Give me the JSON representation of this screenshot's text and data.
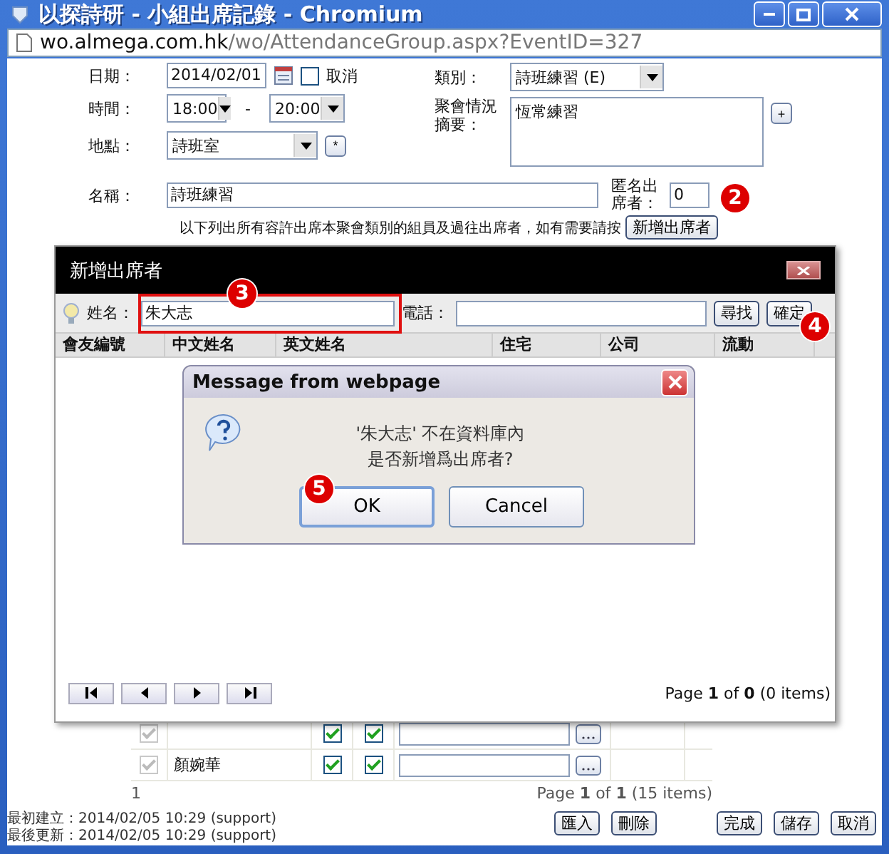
{
  "window": {
    "title": "以探詩研 - 小組出席記錄 - Chromium"
  },
  "address_bar": {
    "host": "wo.almega.com.hk",
    "path": "/wo/AttendanceGroup.aspx?EventID=327"
  },
  "form": {
    "date_label": "日期：",
    "date": "2014/02/01",
    "cancel_label": "取消",
    "cancel_checked": false,
    "time_label": "時間：",
    "start_time": "18:00",
    "time_dash": "-",
    "end_time": "20:00",
    "place_label": "地點：",
    "place": "詩班室",
    "place_button": "*",
    "category_label": "類別：",
    "category": "詩班練習 (E)",
    "summary_label": "聚會情況摘要：",
    "summary": "恆常練習",
    "summary_button": "+",
    "name_label": "名稱：",
    "name": "詩班練習",
    "anonymous_label": "匿名出席者：",
    "anonymous": "0",
    "hint": "以下列出所有容許出席本聚會類別的組員及過往出席者，如有需要請按",
    "add_button": "新增出席者"
  },
  "members": [
    {
      "locked": true,
      "attended": true,
      "member": true
    },
    {
      "name": "顏婉華",
      "locked": true,
      "attended": true,
      "member": true
    }
  ],
  "members_pager": {
    "page_link": "1",
    "summary": "Page **1** of **1** (15 items)"
  },
  "footer": {
    "created_label": "最初建立：",
    "created": "2014/02/05 10:29 (support)",
    "updated_label": "最後更新：",
    "updated": "2014/02/05 10:29 (support)",
    "buttons": [
      "匯入",
      "刪除",
      "完成",
      "儲存",
      "取消"
    ]
  },
  "dialog": {
    "title": "新增出席者",
    "name_label": "姓名：",
    "name_value": "朱大志",
    "phone_label": "電話：",
    "buttons": [
      "尋找",
      "確定"
    ],
    "columns": [
      "會友編號",
      "中文姓名",
      "英文姓名",
      "住宅",
      "公司",
      "流動"
    ],
    "pager_summary": "Page **1** of **0** (0 items)"
  },
  "message_box": {
    "title": "Message from webpage",
    "lines": [
      "'朱大志' 不在資料庫內",
      "是否新增爲出席者?"
    ],
    "buttons": [
      {
        "label": "OK",
        "selected": true
      },
      {
        "label": "Cancel",
        "selected": false
      }
    ]
  },
  "annotations": [
    {
      "label": "2",
      "kind": "add"
    },
    {
      "label": "3",
      "kind": "name"
    },
    {
      "label": "4",
      "kind": "confirm"
    },
    {
      "label": "5",
      "kind": "ok"
    }
  ]
}
